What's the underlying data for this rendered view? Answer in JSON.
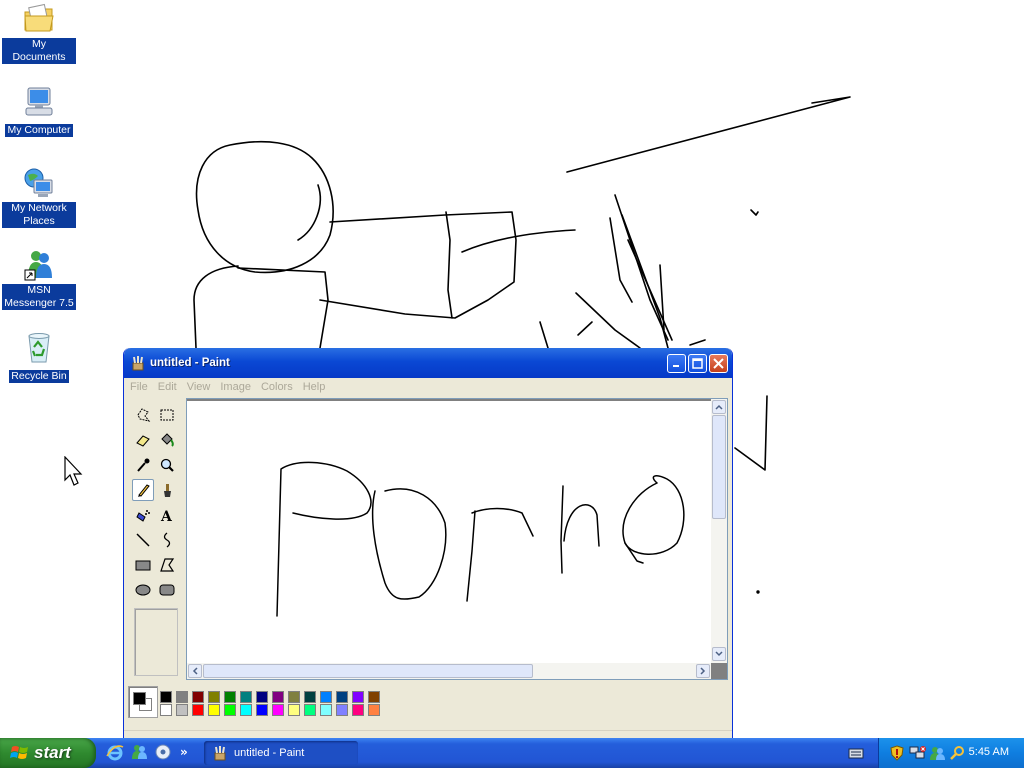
{
  "desktop": {
    "icons": [
      {
        "label": "My Documents"
      },
      {
        "label": "My Computer"
      },
      {
        "label": "My Network Places"
      },
      {
        "label": "MSN Messenger 7.5"
      },
      {
        "label": "Recycle Bin"
      }
    ]
  },
  "paint": {
    "title": "untitled - Paint",
    "menu": [
      "File",
      "Edit",
      "View",
      "Image",
      "Colors",
      "Help"
    ],
    "tools": [
      "free-form-select",
      "select",
      "eraser",
      "fill-with-color",
      "pick-color",
      "magnifier",
      "pencil",
      "brush",
      "airbrush",
      "text",
      "line",
      "curve",
      "rectangle",
      "polygon",
      "ellipse",
      "rounded-rectangle"
    ],
    "selected_tool": "pencil",
    "foreground_color": "#000000",
    "background_color": "#ffffff",
    "palette_top": [
      "#000000",
      "#808080",
      "#800000",
      "#808000",
      "#008000",
      "#008080",
      "#000080",
      "#800080",
      "#808040",
      "#004040",
      "#0080ff",
      "#004080",
      "#8000ff",
      "#804000"
    ],
    "palette_bottom": [
      "#ffffff",
      "#c0c0c0",
      "#ff0000",
      "#ffff00",
      "#00ff00",
      "#00ffff",
      "#0000ff",
      "#ff00ff",
      "#ffff80",
      "#00ff80",
      "#80ffff",
      "#8080ff",
      "#ff0080",
      "#ff8040"
    ]
  },
  "taskbar": {
    "start_label": "start",
    "task_button_label": "untitled - Paint",
    "clock": "5:45 AM",
    "colors": {
      "bar": "#245edb",
      "start": "#3c9a3c",
      "tray": "#0f7ee0"
    }
  }
}
